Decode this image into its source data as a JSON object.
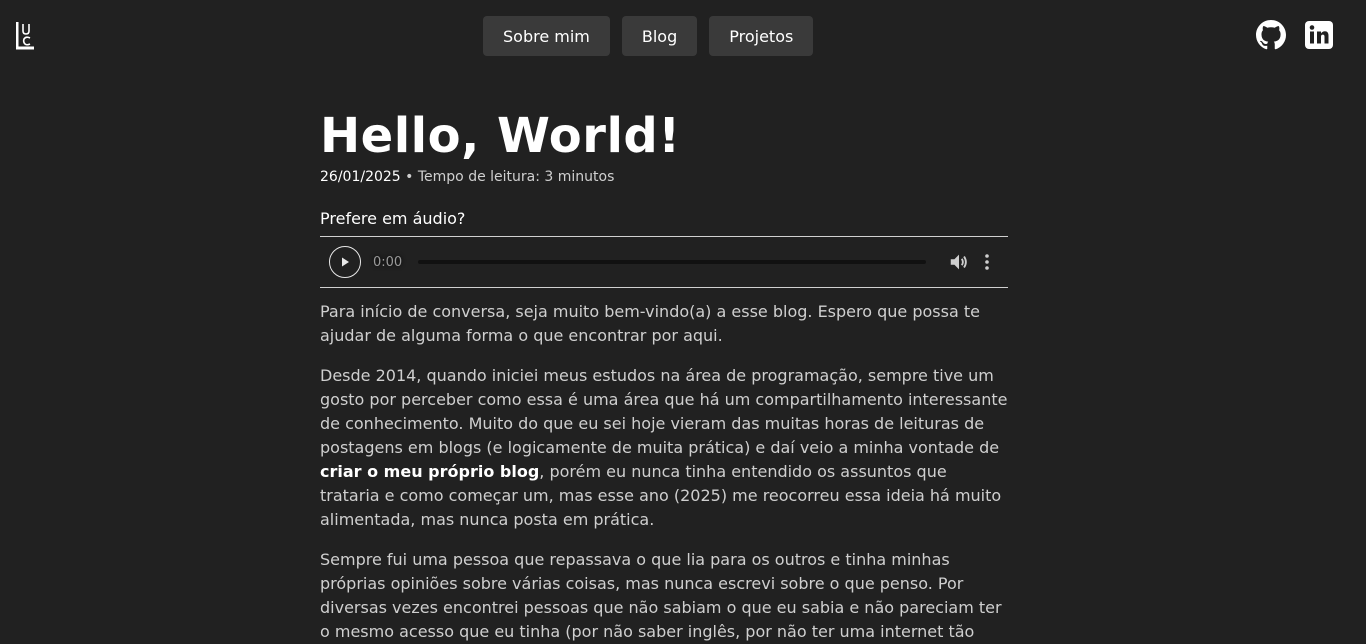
{
  "nav": {
    "items": [
      {
        "label": "Sobre mim"
      },
      {
        "label": "Blog"
      },
      {
        "label": "Projetos"
      }
    ]
  },
  "social": {
    "icons": [
      "github-icon",
      "linkedin-icon"
    ]
  },
  "post": {
    "title": "Hello, World!",
    "date": "26/01/2025",
    "separator": "•",
    "reading_time": "Tempo de leitura: 3 minutos",
    "audio_label": "Prefere em áudio?",
    "audio_time": "0:00",
    "p1": "Para início de conversa, seja muito bem-vindo(a) a esse blog. Espero que possa te ajudar de alguma forma o que encontrar por aqui.",
    "p2_before": "Desde 2014, quando iniciei meus estudos na área de programação, sempre tive um gosto por perceber como essa é uma área que há um compartilhamento interessante de conhecimento. Muito do que eu sei hoje vieram das muitas horas de leituras de postagens em blogs (e logicamente de muita prática) e daí veio a minha vontade de ",
    "p2_bold": "criar o meu próprio blog",
    "p2_after": ", porém eu nunca tinha entendido os assuntos que trataria e como começar um, mas esse ano (2025) me reocorreu essa ideia há muito alimentada, mas nunca posta em prática.",
    "p3": "Sempre fui uma pessoa que repassava o que lia para os outros e tinha minhas próprias opiniões sobre várias coisas, mas nunca escrevi sobre o que penso. Por diversas vezes encontrei pessoas que não sabiam o que eu sabia e não pareciam ter o mesmo acesso que eu tinha (por não saber inglês, por não ter uma internet tão"
  }
}
